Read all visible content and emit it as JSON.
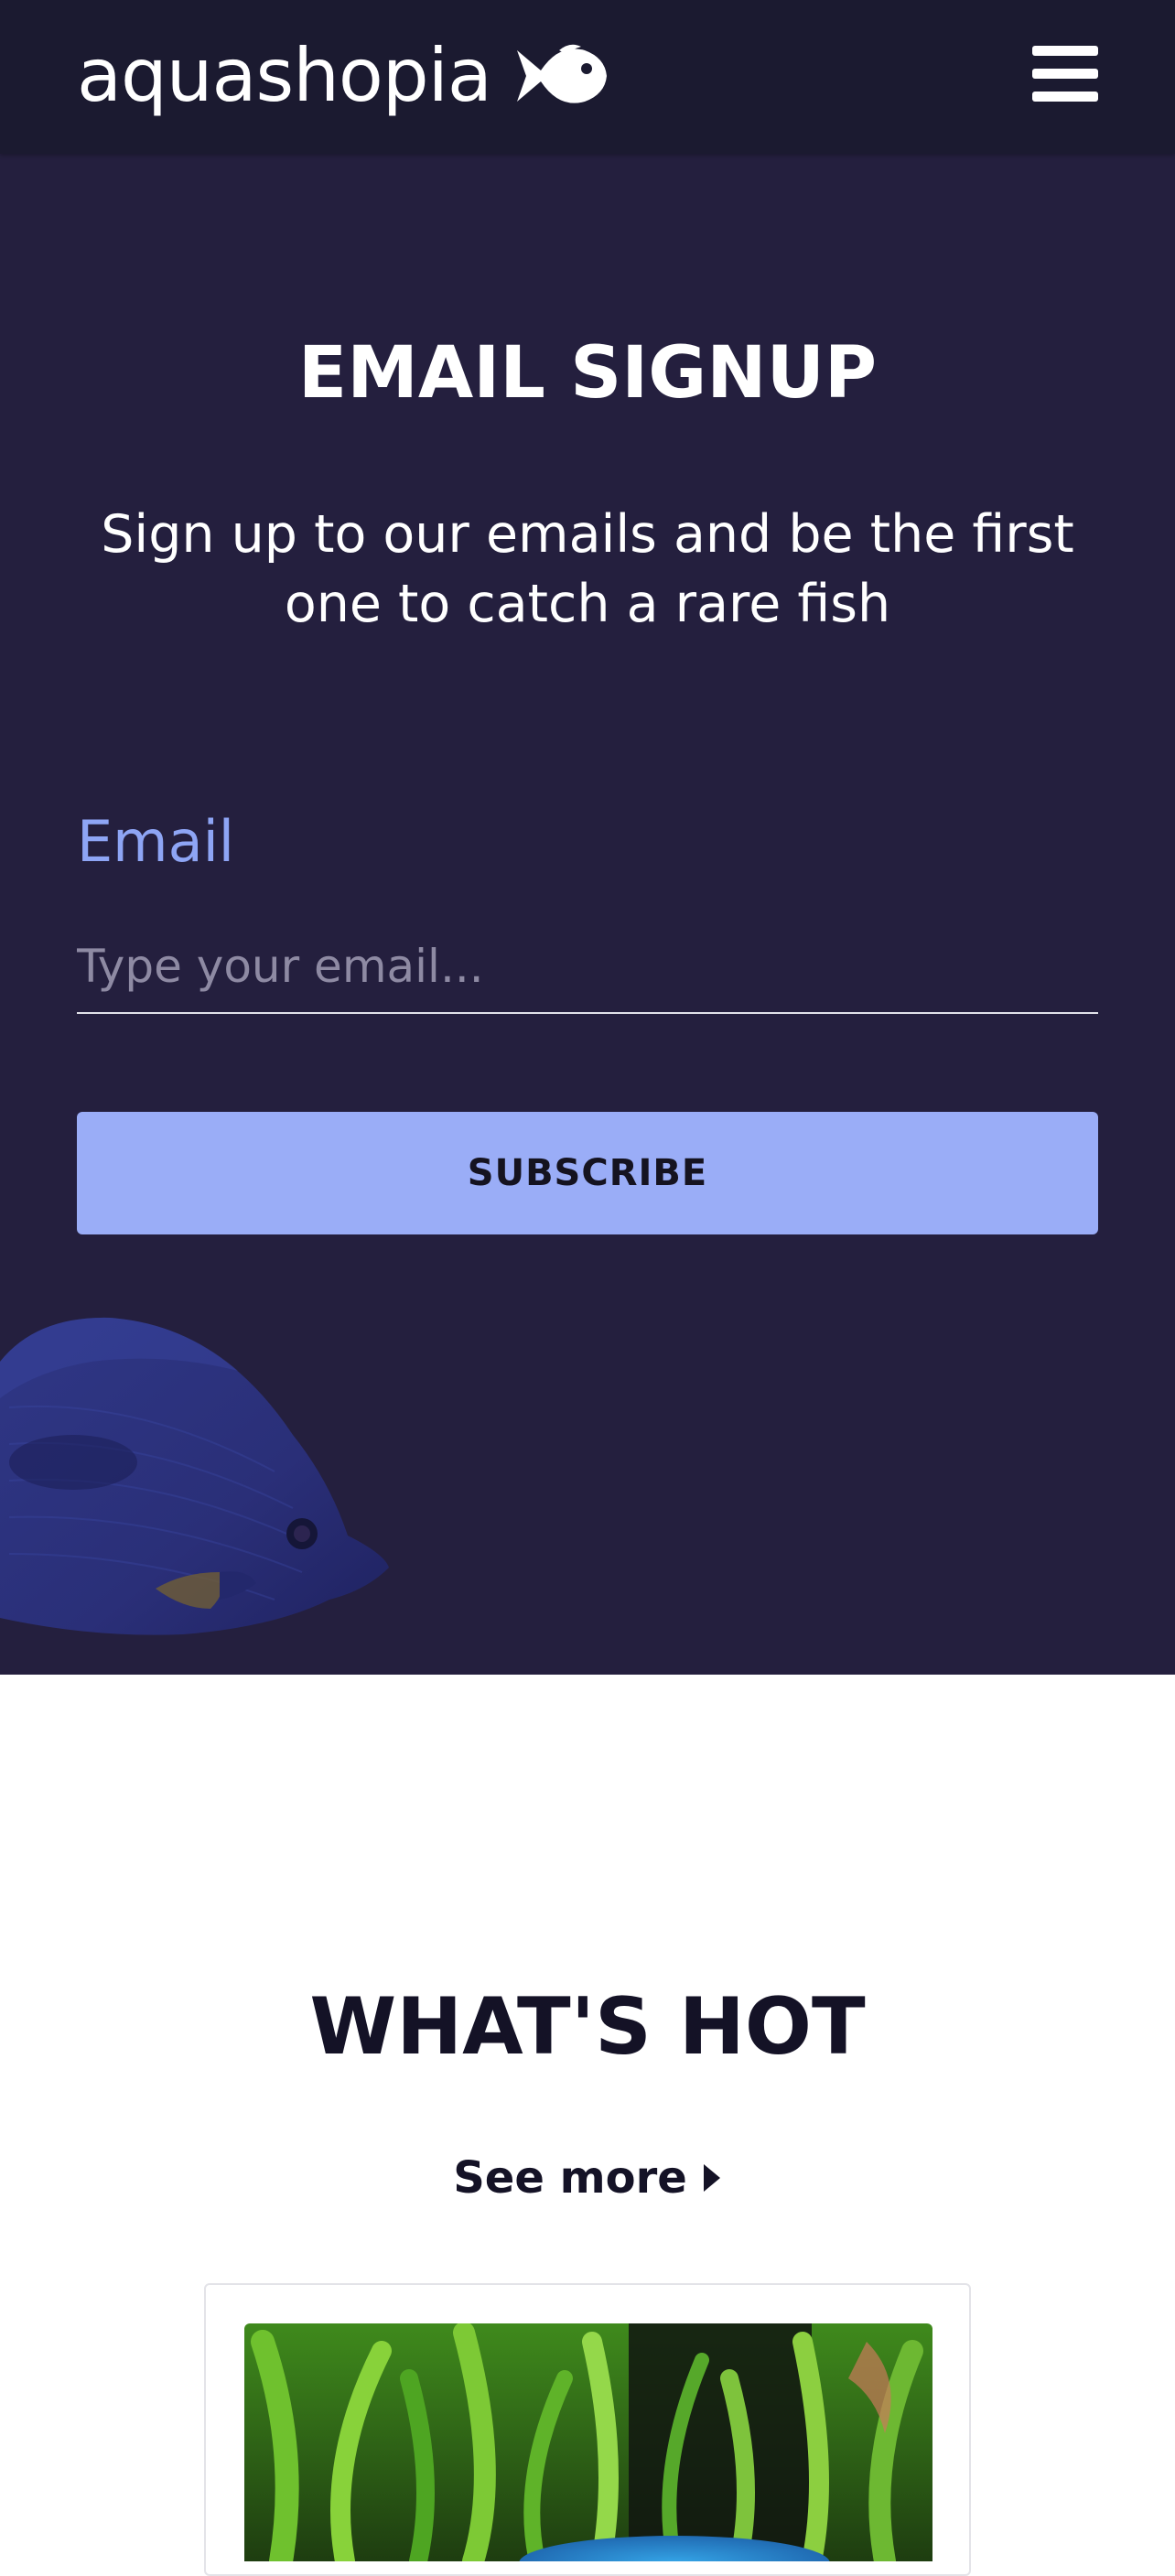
{
  "navbar": {
    "brand": "aquashopia",
    "brand_icon": "fish-icon",
    "menu_icon": "hamburger-menu-icon"
  },
  "signup": {
    "title": "EMAIL SIGNUP",
    "subtitle": "Sign up to our emails and be the first one to catch a rare fish",
    "email_label": "Email",
    "email_placeholder": "Type your email...",
    "email_value": "",
    "button_label": "SUBSCRIBE"
  },
  "whats_hot": {
    "title": "WHAT'S HOT",
    "see_more": "See more",
    "see_more_icon": "caret-right-icon"
  },
  "colors": {
    "navbar_bg": "#1b1a30",
    "section_bg": "#241f3e",
    "accent": "#9aadf7",
    "label": "#8ea5f5",
    "heading_dark": "#141226"
  }
}
